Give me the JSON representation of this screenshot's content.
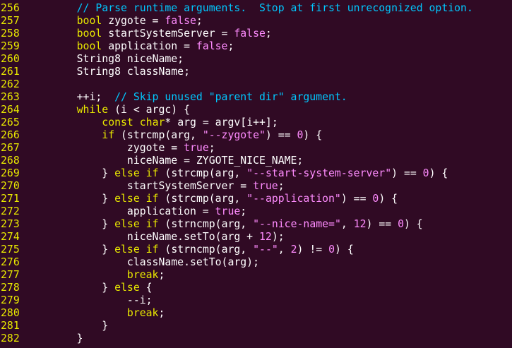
{
  "editor": {
    "colors": {
      "background": "#300a24",
      "line_number": "#e8e800",
      "keyword": "#e8e800",
      "comment": "#00c8ff",
      "string": "#ff8cff",
      "number": "#ff8cff",
      "text": "#ffffff"
    },
    "lines": [
      {
        "n": "256",
        "indent": "    ",
        "tokens": [
          {
            "t": "// Parse runtime arguments.  Stop at first unrecognized option.",
            "k": "comment"
          }
        ]
      },
      {
        "n": "257",
        "indent": "    ",
        "tokens": [
          {
            "t": "bool",
            "k": "keyword"
          },
          {
            "t": " zygote = ",
            "k": "plain"
          },
          {
            "t": "false",
            "k": "string"
          },
          {
            "t": ";",
            "k": "plain"
          }
        ]
      },
      {
        "n": "258",
        "indent": "    ",
        "tokens": [
          {
            "t": "bool",
            "k": "keyword"
          },
          {
            "t": " startSystemServer = ",
            "k": "plain"
          },
          {
            "t": "false",
            "k": "string"
          },
          {
            "t": ";",
            "k": "plain"
          }
        ]
      },
      {
        "n": "259",
        "indent": "    ",
        "tokens": [
          {
            "t": "bool",
            "k": "keyword"
          },
          {
            "t": " application = ",
            "k": "plain"
          },
          {
            "t": "false",
            "k": "string"
          },
          {
            "t": ";",
            "k": "plain"
          }
        ]
      },
      {
        "n": "260",
        "indent": "    ",
        "tokens": [
          {
            "t": "String8 niceName;",
            "k": "plain"
          }
        ]
      },
      {
        "n": "261",
        "indent": "    ",
        "tokens": [
          {
            "t": "String8 className;",
            "k": "plain"
          }
        ]
      },
      {
        "n": "262",
        "indent": "",
        "tokens": []
      },
      {
        "n": "263",
        "indent": "    ",
        "tokens": [
          {
            "t": "++i;  ",
            "k": "plain"
          },
          {
            "t": "// Skip unused \"parent dir\" argument.",
            "k": "comment"
          }
        ]
      },
      {
        "n": "264",
        "indent": "    ",
        "tokens": [
          {
            "t": "while",
            "k": "ctrl"
          },
          {
            "t": " (i < argc) {",
            "k": "plain"
          }
        ]
      },
      {
        "n": "265",
        "indent": "        ",
        "tokens": [
          {
            "t": "const",
            "k": "keyword"
          },
          {
            "t": " ",
            "k": "plain"
          },
          {
            "t": "char",
            "k": "keyword"
          },
          {
            "t": "* arg = argv[i++];",
            "k": "plain"
          }
        ]
      },
      {
        "n": "266",
        "indent": "        ",
        "tokens": [
          {
            "t": "if",
            "k": "ctrl"
          },
          {
            "t": " (strcmp(arg, ",
            "k": "plain"
          },
          {
            "t": "\"--zygote\"",
            "k": "string"
          },
          {
            "t": ") == ",
            "k": "plain"
          },
          {
            "t": "0",
            "k": "number"
          },
          {
            "t": ") {",
            "k": "plain"
          }
        ]
      },
      {
        "n": "267",
        "indent": "            ",
        "tokens": [
          {
            "t": "zygote = ",
            "k": "plain"
          },
          {
            "t": "true",
            "k": "string"
          },
          {
            "t": ";",
            "k": "plain"
          }
        ]
      },
      {
        "n": "268",
        "indent": "            ",
        "tokens": [
          {
            "t": "niceName = ZYGOTE_NICE_NAME;",
            "k": "plain"
          }
        ]
      },
      {
        "n": "269",
        "indent": "        ",
        "tokens": [
          {
            "t": "} ",
            "k": "plain"
          },
          {
            "t": "else",
            "k": "ctrl"
          },
          {
            "t": " ",
            "k": "plain"
          },
          {
            "t": "if",
            "k": "ctrl"
          },
          {
            "t": " (strcmp(arg, ",
            "k": "plain"
          },
          {
            "t": "\"--start-system-server\"",
            "k": "string"
          },
          {
            "t": ") == ",
            "k": "plain"
          },
          {
            "t": "0",
            "k": "number"
          },
          {
            "t": ") {",
            "k": "plain"
          }
        ]
      },
      {
        "n": "270",
        "indent": "            ",
        "tokens": [
          {
            "t": "startSystemServer = ",
            "k": "plain"
          },
          {
            "t": "true",
            "k": "string"
          },
          {
            "t": ";",
            "k": "plain"
          }
        ]
      },
      {
        "n": "271",
        "indent": "        ",
        "tokens": [
          {
            "t": "} ",
            "k": "plain"
          },
          {
            "t": "else",
            "k": "ctrl"
          },
          {
            "t": " ",
            "k": "plain"
          },
          {
            "t": "if",
            "k": "ctrl"
          },
          {
            "t": " (strcmp(arg, ",
            "k": "plain"
          },
          {
            "t": "\"--application\"",
            "k": "string"
          },
          {
            "t": ") == ",
            "k": "plain"
          },
          {
            "t": "0",
            "k": "number"
          },
          {
            "t": ") {",
            "k": "plain"
          }
        ]
      },
      {
        "n": "272",
        "indent": "            ",
        "tokens": [
          {
            "t": "application = ",
            "k": "plain"
          },
          {
            "t": "true",
            "k": "string"
          },
          {
            "t": ";",
            "k": "plain"
          }
        ]
      },
      {
        "n": "273",
        "indent": "        ",
        "tokens": [
          {
            "t": "} ",
            "k": "plain"
          },
          {
            "t": "else",
            "k": "ctrl"
          },
          {
            "t": " ",
            "k": "plain"
          },
          {
            "t": "if",
            "k": "ctrl"
          },
          {
            "t": " (strncmp(arg, ",
            "k": "plain"
          },
          {
            "t": "\"--nice-name=\"",
            "k": "string"
          },
          {
            "t": ", ",
            "k": "plain"
          },
          {
            "t": "12",
            "k": "number"
          },
          {
            "t": ") == ",
            "k": "plain"
          },
          {
            "t": "0",
            "k": "number"
          },
          {
            "t": ") {",
            "k": "plain"
          }
        ]
      },
      {
        "n": "274",
        "indent": "            ",
        "tokens": [
          {
            "t": "niceName.setTo(arg + ",
            "k": "plain"
          },
          {
            "t": "12",
            "k": "number"
          },
          {
            "t": ");",
            "k": "plain"
          }
        ]
      },
      {
        "n": "275",
        "indent": "        ",
        "tokens": [
          {
            "t": "} ",
            "k": "plain"
          },
          {
            "t": "else",
            "k": "ctrl"
          },
          {
            "t": " ",
            "k": "plain"
          },
          {
            "t": "if",
            "k": "ctrl"
          },
          {
            "t": " (strncmp(arg, ",
            "k": "plain"
          },
          {
            "t": "\"--\"",
            "k": "string"
          },
          {
            "t": ", ",
            "k": "plain"
          },
          {
            "t": "2",
            "k": "number"
          },
          {
            "t": ") != ",
            "k": "plain"
          },
          {
            "t": "0",
            "k": "number"
          },
          {
            "t": ") {",
            "k": "plain"
          }
        ]
      },
      {
        "n": "276",
        "indent": "            ",
        "tokens": [
          {
            "t": "className.setTo(arg);",
            "k": "plain"
          }
        ]
      },
      {
        "n": "277",
        "indent": "            ",
        "tokens": [
          {
            "t": "break",
            "k": "ctrl"
          },
          {
            "t": ";",
            "k": "plain"
          }
        ]
      },
      {
        "n": "278",
        "indent": "        ",
        "tokens": [
          {
            "t": "} ",
            "k": "plain"
          },
          {
            "t": "else",
            "k": "ctrl"
          },
          {
            "t": " {",
            "k": "plain"
          }
        ]
      },
      {
        "n": "279",
        "indent": "            ",
        "tokens": [
          {
            "t": "--i;",
            "k": "plain"
          }
        ]
      },
      {
        "n": "280",
        "indent": "            ",
        "tokens": [
          {
            "t": "break",
            "k": "ctrl"
          },
          {
            "t": ";",
            "k": "plain"
          }
        ]
      },
      {
        "n": "281",
        "indent": "        ",
        "tokens": [
          {
            "t": "}",
            "k": "plain"
          }
        ]
      },
      {
        "n": "282",
        "indent": "    ",
        "tokens": [
          {
            "t": "}",
            "k": "plain"
          }
        ]
      }
    ]
  }
}
